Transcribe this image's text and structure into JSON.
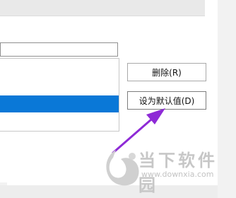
{
  "dialog": {
    "buttons": {
      "delete_label": "删除(R)",
      "set_default_label": "设为默认值(D)"
    },
    "list": {
      "selected_row_color": "#0a78d7"
    }
  },
  "annotation": {
    "arrow_color": "#8e2ad6"
  },
  "watermark": {
    "logo_name": "downxia-logo",
    "text": "当下软件园",
    "url": "www.downxia.com"
  }
}
